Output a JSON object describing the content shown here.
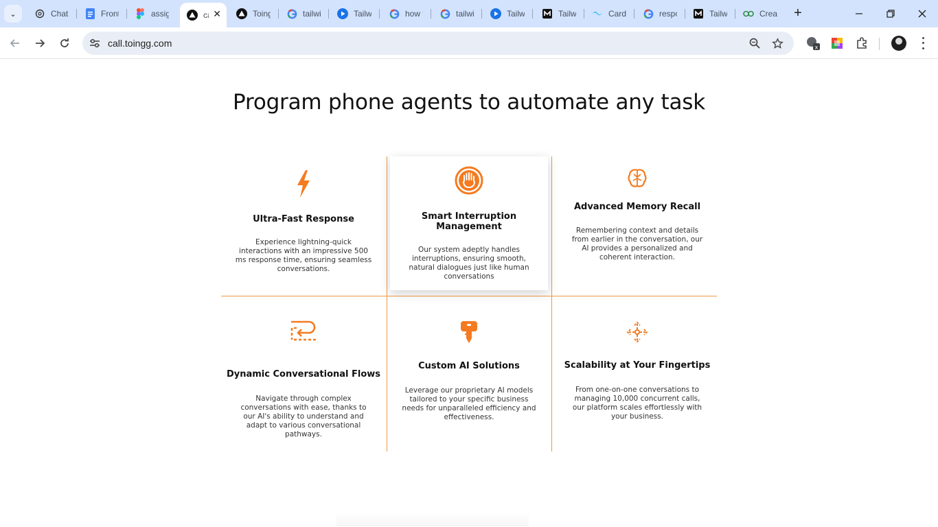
{
  "tabs": [
    {
      "title": "ChatGPT",
      "icon": "openai-icon"
    },
    {
      "title": "Frontend",
      "icon": "docs-icon"
    },
    {
      "title": "assignment",
      "icon": "figma-icon"
    },
    {
      "title": "call",
      "icon": "triangle-logo-icon",
      "active": true
    },
    {
      "title": "Toingg",
      "icon": "triangle-logo-icon"
    },
    {
      "title": "tailwind",
      "icon": "google-icon"
    },
    {
      "title": "Tailwind",
      "icon": "play-icon"
    },
    {
      "title": "how to",
      "icon": "google-icon"
    },
    {
      "title": "tailwind",
      "icon": "google-icon"
    },
    {
      "title": "Tailwind",
      "icon": "play-icon"
    },
    {
      "title": "Tailwind",
      "icon": "medium-icon"
    },
    {
      "title": "Cards",
      "icon": "tailwind-icon"
    },
    {
      "title": "response",
      "icon": "google-icon"
    },
    {
      "title": "Tailwind",
      "icon": "medium-icon"
    },
    {
      "title": "Create",
      "icon": "geeks-icon"
    }
  ],
  "address_bar": {
    "url": "call.toingg.com"
  },
  "page": {
    "heading": "Program phone agents to automate any task",
    "accent_color": "#f47b20",
    "features": [
      {
        "title": "Ultra-Fast Response",
        "icon": "lightning-icon",
        "description": "Experience lightning-quick interactions with an impressive 500 ms response time, ensuring seamless conversations."
      },
      {
        "title": "Smart Interruption Management",
        "icon": "stop-hand-icon",
        "description": "Our system adeptly handles interruptions, ensuring smooth, natural dialogues just like human conversations"
      },
      {
        "title": "Advanced Memory Recall",
        "icon": "brain-icon",
        "description": "Remembering context and details from earlier in the conversation, our AI provides a personalized and coherent interaction."
      },
      {
        "title": "Dynamic Conversational Flows",
        "icon": "flow-arrows-icon",
        "description": "Navigate through complex conversations with ease, thanks to our AI's ability to understand and adapt to various conversational pathways."
      },
      {
        "title": "Custom AI Solutions",
        "icon": "key-icon",
        "description": "Leverage our proprietary AI models tailored to your specific business needs for unparalleled efficiency and effectiveness."
      },
      {
        "title": "Scalability at Your Fingertips",
        "icon": "expand-arrows-icon",
        "description": "From one-on-one conversations to managing 10,000 concurrent calls, our platform scales effortlessly with your business."
      }
    ]
  }
}
